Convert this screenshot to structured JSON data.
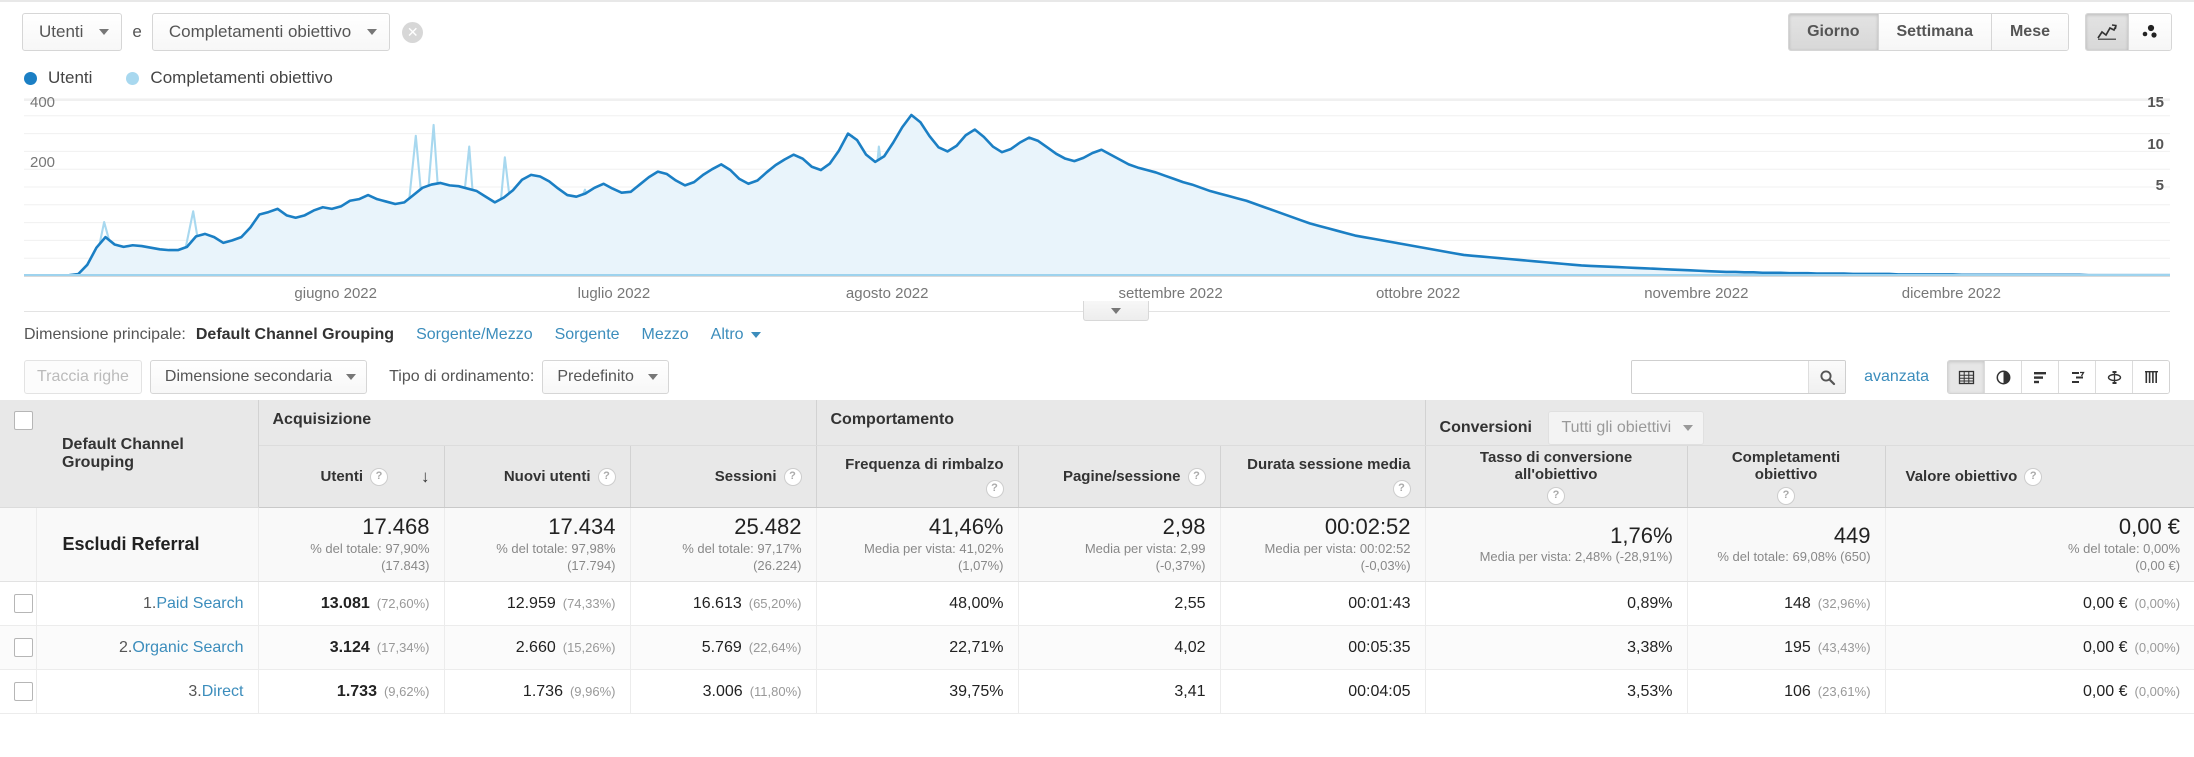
{
  "topbar": {
    "metric_primary": "Utenti",
    "conjunction": "e",
    "metric_secondary": "Completamenti obiettivo",
    "clear_glyph": "✕",
    "granularity": [
      {
        "label": "Giorno",
        "active": true
      },
      {
        "label": "Settimana",
        "active": false
      },
      {
        "label": "Mese",
        "active": false
      }
    ],
    "chart_type_buttons": [
      {
        "name": "line-chart-icon",
        "active": true
      },
      {
        "name": "motion-chart-icon",
        "active": false
      }
    ]
  },
  "legend": [
    {
      "label": "Utenti",
      "color": "#1b7fc4"
    },
    {
      "label": "Completamenti obiettivo",
      "color": "#a8d8ef"
    }
  ],
  "chart_data": {
    "type": "line",
    "title": "",
    "xlabel": "",
    "ylabel": "",
    "left_axis": {
      "label": "Utenti",
      "ticks": [
        200,
        400
      ],
      "min": 0,
      "max": 440,
      "color": "#1b7fc4"
    },
    "right_axis": {
      "label": "Completamenti obiettivo",
      "ticks": [
        5,
        10,
        15
      ],
      "min": 0,
      "max": 16.5,
      "color": "#a8d8ef"
    },
    "grid": true,
    "legend_position": "top-left",
    "x_ticks": [
      {
        "label": "giugno 2022",
        "pos_pct": 12.6
      },
      {
        "label": "luglio 2022",
        "pos_pct": 25.8
      },
      {
        "label": "agosto 2022",
        "pos_pct": 38.3
      },
      {
        "label": "settembre 2022",
        "pos_pct": 51.0
      },
      {
        "label": "ottobre 2022",
        "pos_pct": 63.0
      },
      {
        "label": "novembre 2022",
        "pos_pct": 75.5
      },
      {
        "label": "dicembre 2022",
        "pos_pct": 87.5
      }
    ],
    "series": [
      {
        "name": "Utenti",
        "color": "#1b7fc4",
        "axis": "left",
        "values": [
          0,
          0,
          0,
          0,
          0,
          2,
          5,
          28,
          70,
          96,
          78,
          72,
          76,
          74,
          70,
          66,
          64,
          64,
          72,
          98,
          104,
          96,
          82,
          88,
          96,
          120,
          152,
          158,
          166,
          150,
          144,
          150,
          162,
          170,
          166,
          172,
          186,
          190,
          200,
          190,
          184,
          178,
          182,
          200,
          218,
          226,
          230,
          224,
          222,
          216,
          210,
          196,
          182,
          194,
          212,
          238,
          250,
          246,
          234,
          216,
          200,
          196,
          204,
          218,
          228,
          216,
          206,
          208,
          226,
          244,
          258,
          252,
          236,
          224,
          232,
          250,
          264,
          276,
          262,
          240,
          228,
          236,
          256,
          274,
          288,
          300,
          290,
          270,
          262,
          278,
          310,
          352,
          336,
          300,
          282,
          296,
          330,
          368,
          398,
          380,
          346,
          318,
          308,
          322,
          348,
          362,
          344,
          320,
          306,
          314,
          330,
          342,
          334,
          318,
          302,
          290,
          284,
          292,
          304,
          312,
          300,
          288,
          276,
          268,
          262,
          256,
          248,
          240,
          232,
          226,
          218,
          210,
          204,
          198,
          192,
          186,
          178,
          170,
          162,
          154,
          146,
          138,
          130,
          124,
          118,
          112,
          106,
          100,
          96,
          92,
          88,
          84,
          80,
          76,
          72,
          68,
          64,
          60,
          56,
          52,
          50,
          48,
          46,
          44,
          42,
          40,
          38,
          36,
          34,
          32,
          30,
          28,
          26,
          25,
          24,
          23,
          22,
          21,
          20,
          19,
          18,
          17,
          16,
          15,
          14,
          13,
          12,
          11,
          10,
          10,
          9,
          9,
          8,
          8,
          8,
          7,
          7,
          7,
          6,
          6,
          6,
          6,
          5,
          5,
          5,
          5,
          5,
          4,
          4,
          4,
          4,
          4,
          4,
          4,
          3,
          3,
          3,
          3,
          3,
          3,
          3,
          3,
          3,
          3,
          3,
          3,
          3,
          3,
          2,
          2,
          2,
          2,
          2,
          2,
          2,
          2,
          2,
          2
        ]
      },
      {
        "name": "Completamenti obiettivo",
        "color": "#a8d8ef",
        "axis": "right",
        "values": [
          0,
          0,
          0,
          0,
          0,
          0,
          0,
          0,
          1,
          5,
          2,
          0,
          1,
          0,
          0,
          0,
          0,
          1,
          2,
          6,
          1,
          0,
          0,
          0,
          1,
          3,
          1,
          2,
          5,
          1,
          0,
          2,
          4,
          3,
          2,
          1,
          3,
          6,
          2,
          4,
          3,
          1,
          2,
          5,
          13,
          4,
          14,
          2,
          5,
          4,
          12,
          1,
          3,
          2,
          11,
          4,
          2,
          5,
          3,
          1,
          4,
          2,
          6,
          8,
          5,
          2,
          6,
          3,
          5,
          7,
          4,
          2,
          5,
          3,
          6,
          2,
          7,
          3,
          5,
          2,
          6,
          8,
          4,
          5,
          3,
          7,
          2,
          5,
          3,
          8,
          2,
          6,
          4,
          13,
          5,
          3,
          12,
          6,
          4,
          7,
          5,
          3,
          9,
          4,
          6,
          2,
          4,
          5,
          3,
          6,
          2,
          4,
          3,
          5,
          2,
          4,
          3,
          2,
          4,
          2,
          3,
          2,
          2,
          3,
          2,
          2,
          1,
          2,
          1,
          2,
          1,
          1,
          1,
          1,
          1,
          0,
          1,
          0,
          1,
          0,
          1,
          0,
          0,
          1,
          0,
          0,
          0,
          1,
          0,
          0,
          0,
          0,
          1,
          0,
          0,
          0,
          0,
          0,
          0,
          0,
          0,
          1,
          0,
          0,
          0,
          0,
          0,
          0,
          0,
          0,
          0,
          0,
          0,
          0,
          1,
          0,
          0,
          0,
          0,
          0,
          0,
          0,
          0,
          0,
          0,
          0,
          0,
          0,
          0,
          0,
          0,
          0,
          0,
          0,
          0,
          0,
          0,
          0,
          0,
          0,
          0,
          0,
          0,
          0,
          0,
          0,
          0,
          0,
          0,
          0,
          0,
          0,
          0,
          0,
          0,
          0,
          0,
          0,
          0,
          0,
          0,
          0,
          0,
          0,
          0,
          0,
          0,
          0,
          0,
          0,
          0,
          0,
          0,
          0,
          0,
          0,
          0,
          0,
          0,
          0,
          0,
          0
        ]
      }
    ]
  },
  "primary_dimension": {
    "label": "Dimensione principale:",
    "active": "Default Channel Grouping",
    "links": [
      "Sorgente/Mezzo",
      "Sorgente",
      "Mezzo"
    ],
    "more": "Altro"
  },
  "table_toolbar": {
    "track_rows_placeholder": "Traccia righe",
    "secondary_dimension": "Dimensione secondaria",
    "sort_type_label": "Tipo di ordinamento:",
    "sort_type_value": "Predefinito",
    "search_value": "",
    "search_placeholder": "",
    "advanced_label": "avanzata",
    "view_buttons": [
      {
        "name": "table-view-icon",
        "active": true
      },
      {
        "name": "pie-chart-view-icon",
        "active": false
      },
      {
        "name": "performance-bar-view-icon",
        "active": false
      },
      {
        "name": "comparison-view-icon",
        "active": false
      },
      {
        "name": "pivot-view-icon",
        "active": false
      },
      {
        "name": "term-cloud-view-icon",
        "active": false
      }
    ]
  },
  "table": {
    "group_headers": [
      {
        "label": "Acquisizione",
        "span": 3
      },
      {
        "label": "Comportamento",
        "span": 3
      },
      {
        "label": "Conversioni",
        "span": 3,
        "goal_selector": "Tutti gli obiettivi"
      }
    ],
    "dimension_header": "Default Channel Grouping",
    "columns": [
      {
        "label": "Utenti",
        "help": "?",
        "sorted": true,
        "sort_dir": "↓"
      },
      {
        "label": "Nuovi utenti",
        "help": "?"
      },
      {
        "label": "Sessioni",
        "help": "?"
      },
      {
        "label": "Frequenza di rimbalzo",
        "help": "?"
      },
      {
        "label": "Pagine/sessione",
        "help": "?"
      },
      {
        "label": "Durata sessione media",
        "help": "?"
      },
      {
        "label": "Tasso di conversione all'obiettivo",
        "help": "?"
      },
      {
        "label": "Completamenti obiettivo",
        "help": "?"
      },
      {
        "label": "Valore obiettivo",
        "help": "?"
      }
    ],
    "total_row": {
      "label": "Escludi Referral",
      "cells": [
        {
          "value": "17.468",
          "sub1": "% del totale: 97,90%",
          "sub2": "(17.843)"
        },
        {
          "value": "17.434",
          "sub1": "% del totale: 97,98%",
          "sub2": "(17.794)"
        },
        {
          "value": "25.482",
          "sub1": "% del totale: 97,17%",
          "sub2": "(26.224)"
        },
        {
          "value": "41,46%",
          "sub1": "Media per vista: 41,02%",
          "sub2": "(1,07%)"
        },
        {
          "value": "2,98",
          "sub1": "Media per vista: 2,99",
          "sub2": "(-0,37%)"
        },
        {
          "value": "00:02:52",
          "sub1": "Media per vista: 00:02:52",
          "sub2": "(-0,03%)"
        },
        {
          "value": "1,76%",
          "sub1": "Media per vista: 2,48% (-28,91%)",
          "sub2": ""
        },
        {
          "value": "449",
          "sub1": "% del totale: 69,08% (650)",
          "sub2": ""
        },
        {
          "value": "0,00 €",
          "sub1": "% del totale: 0,00%",
          "sub2": "(0,00 €)"
        }
      ]
    },
    "rows": [
      {
        "index": "1.",
        "name": "Paid Search",
        "cells": [
          {
            "value": "13.081",
            "pct": "(72,60%)",
            "bold": true
          },
          {
            "value": "12.959",
            "pct": "(74,33%)"
          },
          {
            "value": "16.613",
            "pct": "(65,20%)"
          },
          {
            "value": "48,00%",
            "pct": ""
          },
          {
            "value": "2,55",
            "pct": ""
          },
          {
            "value": "00:01:43",
            "pct": ""
          },
          {
            "value": "0,89%",
            "pct": ""
          },
          {
            "value": "148",
            "pct": "(32,96%)"
          },
          {
            "value": "0,00 €",
            "pct": "(0,00%)"
          }
        ]
      },
      {
        "index": "2.",
        "name": "Organic Search",
        "cells": [
          {
            "value": "3.124",
            "pct": "(17,34%)",
            "bold": true
          },
          {
            "value": "2.660",
            "pct": "(15,26%)"
          },
          {
            "value": "5.769",
            "pct": "(22,64%)"
          },
          {
            "value": "22,71%",
            "pct": ""
          },
          {
            "value": "4,02",
            "pct": ""
          },
          {
            "value": "00:05:35",
            "pct": ""
          },
          {
            "value": "3,38%",
            "pct": ""
          },
          {
            "value": "195",
            "pct": "(43,43%)"
          },
          {
            "value": "0,00 €",
            "pct": "(0,00%)"
          }
        ]
      },
      {
        "index": "3.",
        "name": "Direct",
        "cells": [
          {
            "value": "1.733",
            "pct": "(9,62%)",
            "bold": true
          },
          {
            "value": "1.736",
            "pct": "(9,96%)"
          },
          {
            "value": "3.006",
            "pct": "(11,80%)"
          },
          {
            "value": "39,75%",
            "pct": ""
          },
          {
            "value": "3,41",
            "pct": ""
          },
          {
            "value": "00:04:05",
            "pct": ""
          },
          {
            "value": "3,53%",
            "pct": ""
          },
          {
            "value": "106",
            "pct": "(23,61%)"
          },
          {
            "value": "0,00 €",
            "pct": "(0,00%)"
          }
        ]
      }
    ]
  },
  "colors": {
    "accent_link": "#3c8dbc",
    "series_primary": "#1b7fc4",
    "series_secondary": "#a8d8ef",
    "header_bg": "#e8e8e8"
  }
}
